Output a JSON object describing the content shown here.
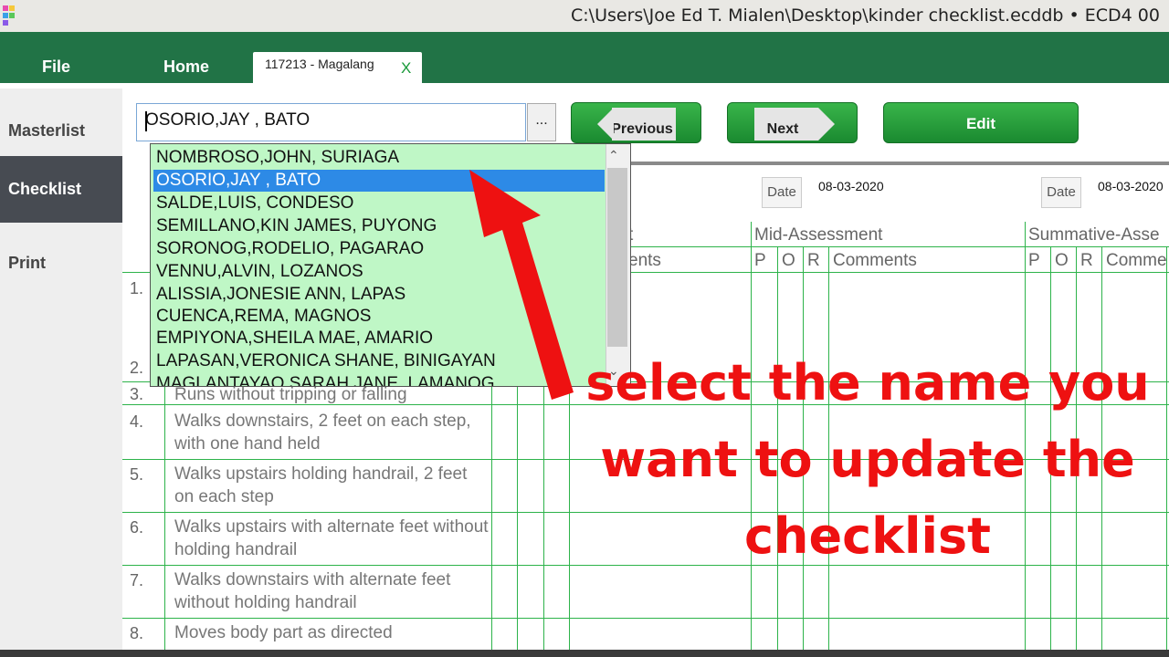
{
  "window": {
    "title": "C:\\Users\\Joe Ed T. Mialen\\Desktop\\kinder checklist.ecddb  •  ECD4 00",
    "icon": "ecd-app-icon"
  },
  "ribbon": {
    "file": "File",
    "home": "Home",
    "doc_tab": "117213 -  Magalang",
    "doc_tab_close": "X"
  },
  "sidebar": {
    "items": [
      {
        "label": "Masterlist"
      },
      {
        "label": "Checklist"
      },
      {
        "label": "Print"
      }
    ]
  },
  "toolbar": {
    "student_value": "OSORIO,JAY , BATO",
    "ellipsis": "...",
    "previous": "Previous",
    "next": "Next",
    "edit": "Edit"
  },
  "dates": [
    {
      "label": "Date",
      "value": "08-03-2020"
    },
    {
      "label": "Date",
      "value": "08-03-2020"
    }
  ],
  "table": {
    "first_header_tail": "t",
    "first_subheader_tail": "ents",
    "mid_assessment": "Mid-Assessment",
    "summative_assessment": "Summative-Asse",
    "cols": [
      "P",
      "O",
      "R",
      "Comments",
      "P",
      "O",
      "R",
      "Comme"
    ],
    "rows": [
      {
        "num": "1.",
        "text": ""
      },
      {
        "num": "2.",
        "text": ""
      },
      {
        "num": "3.",
        "text": "Runs without tripping or falling"
      },
      {
        "num": "4.",
        "text": "Walks downstairs, 2 feet on each step, with one hand held"
      },
      {
        "num": "5.",
        "text": "Walks upstairs holding handrail, 2 feet on each step"
      },
      {
        "num": "6.",
        "text": "Walks upstairs with alternate feet without holding handrail"
      },
      {
        "num": "7.",
        "text": "Walks downstairs with alternate feet without holding handrail"
      },
      {
        "num": "8.",
        "text": "Moves body part as directed"
      }
    ]
  },
  "dropdown": {
    "items": [
      "NOMBROSO,JOHN, SURIAGA",
      "OSORIO,JAY , BATO",
      "SALDE,LUIS, CONDESO",
      "SEMILLANO,KIN JAMES, PUYONG",
      "SORONOG,RODELIO, PAGARAO",
      "VENNU,ALVIN, LOZANOS",
      "ALISSIA,JONESIE ANN, LAPAS",
      "CUENCA,REMA, MAGNOS",
      "EMPIYONA,SHEILA MAE, AMARIO",
      "LAPASAN,VERONICA SHANE, BINIGAYAN",
      "MAGLANTAYAO,SARAH JANE, LAMANOG"
    ],
    "selected_index": 1
  },
  "annotation": {
    "text": "select the name you want to update the checklist",
    "color": "#ee1111"
  },
  "colors": {
    "ribbon": "#217346",
    "accent_green": "#2db34a",
    "selection_blue": "#2d8ae6",
    "dropdown_bg": "#bff7c6"
  }
}
